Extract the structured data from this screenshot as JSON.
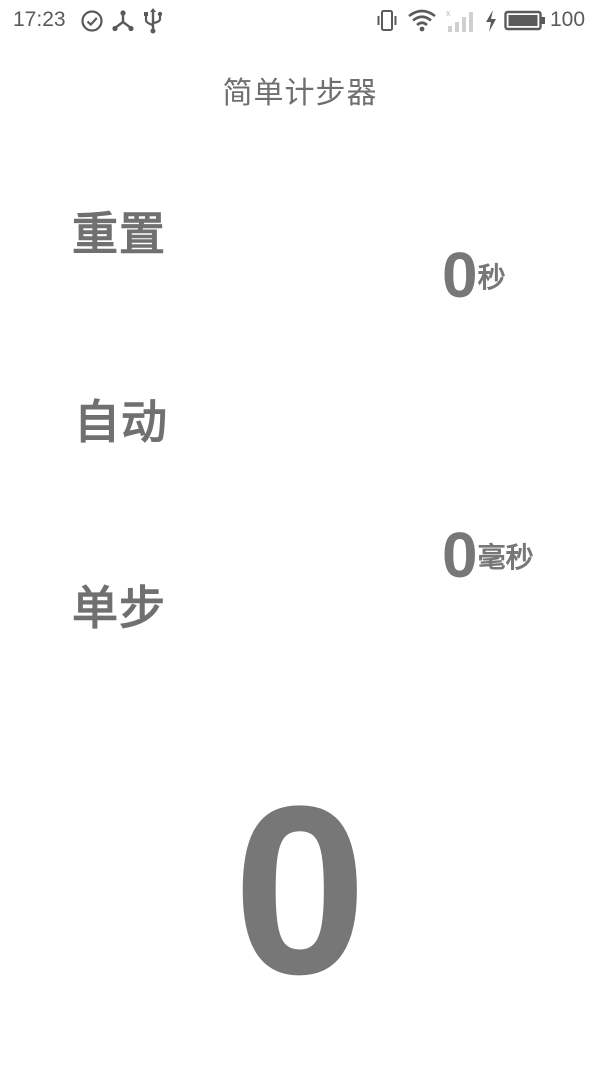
{
  "status_bar": {
    "time": "17:23",
    "battery_level": "100",
    "icons": [
      "check-circle-icon",
      "share-icon",
      "usb-icon",
      "vibrate-icon",
      "wifi-icon",
      "signal-icon",
      "charging-icon",
      "battery-icon"
    ]
  },
  "app": {
    "title": "简单计步器"
  },
  "actions": {
    "reset_label": "重置",
    "auto_label": "自动",
    "step_label": "单步"
  },
  "readouts": {
    "seconds_value": "0",
    "seconds_unit": "秒",
    "ms_value": "0",
    "ms_unit": "毫秒"
  },
  "counter": {
    "steps": "0"
  },
  "colors": {
    "text": "#777777",
    "background": "#ffffff"
  }
}
